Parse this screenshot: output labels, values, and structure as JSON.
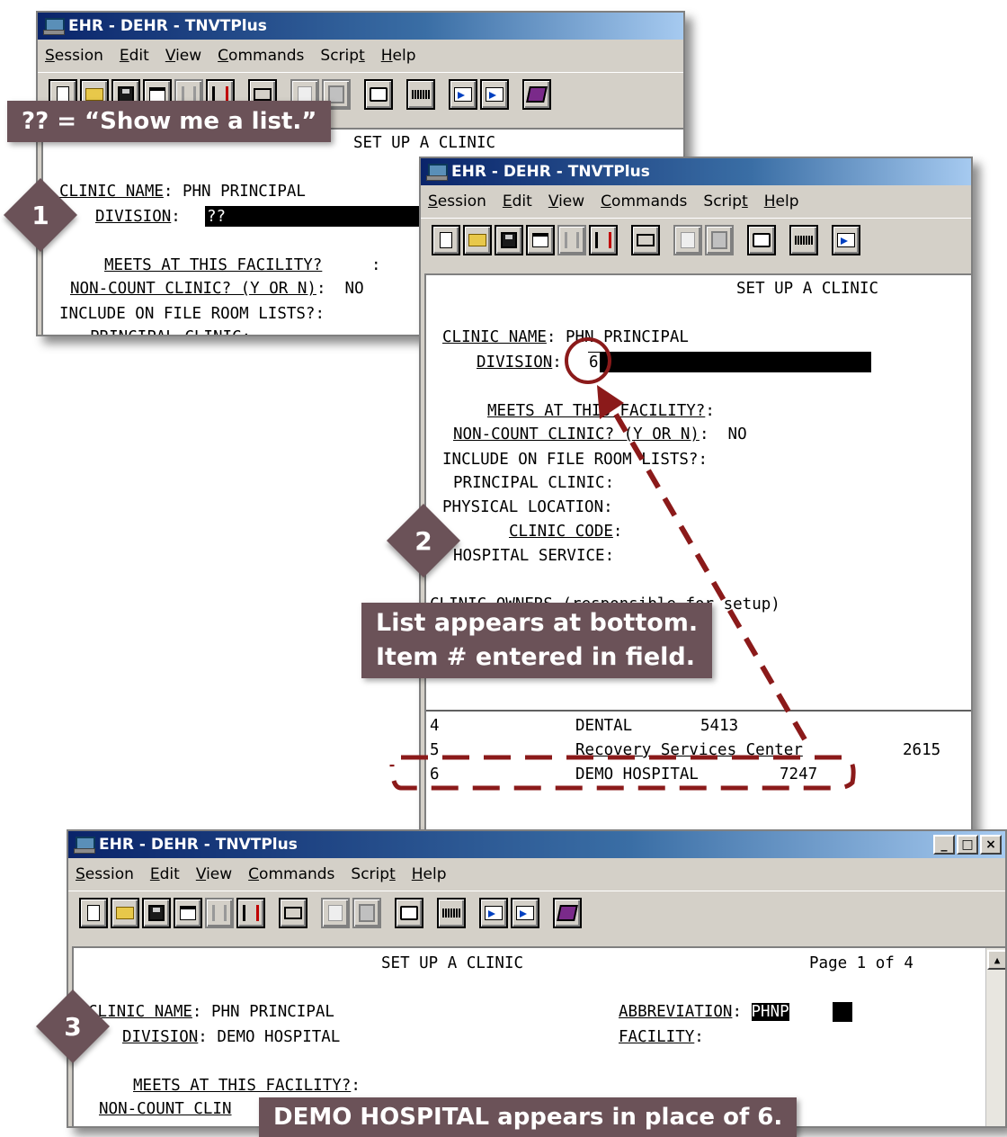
{
  "window1": {
    "title": "EHR - DEHR - TNVTPlus",
    "menu": [
      {
        "pre": "",
        "u": "S",
        "post": "ession"
      },
      {
        "pre": "",
        "u": "E",
        "post": "dit"
      },
      {
        "pre": "",
        "u": "V",
        "post": "iew"
      },
      {
        "pre": "",
        "u": "C",
        "post": "ommands"
      },
      {
        "pre": "Scrip",
        "u": "t",
        "post": ""
      },
      {
        "pre": "",
        "u": "H",
        "post": "elp"
      }
    ],
    "terminal": {
      "screen_title": "SET UP A CLINIC",
      "clinic_name_label": "CLINIC NAME",
      "clinic_name_value": "PHN PRINCIPAL",
      "division_label": "DIVISION",
      "division_value": "??",
      "meets_label": "MEETS AT THIS FACILITY?",
      "noncount_label": "NON-COUNT CLINIC? (Y OR N)",
      "noncount_value": "NO",
      "include_label": "INCLUDE ON FILE ROOM LISTS?:",
      "principal_partial": "PRINCIPAL CLINIC:"
    }
  },
  "window2": {
    "title": "EHR - DEHR - TNVTPlus",
    "terminal": {
      "screen_title": "SET UP A CLINIC",
      "clinic_name_label": "CLINIC NAME",
      "clinic_name_value": "PHN PRINCIPAL",
      "division_label": "DIVISION",
      "division_value": "6",
      "meets_label": "MEETS AT THIS FACILITY?",
      "noncount_label": "NON-COUNT CLINIC? (Y OR N)",
      "noncount_value": "NO",
      "include_label": "INCLUDE ON FILE ROOM LISTS?:",
      "principal_label": "PRINCIPAL CLINIC:",
      "physical_label": "PHYSICAL LOCATION:",
      "clinic_code_label": "CLINIC CODE",
      "hospital_service_label": "HOSPITAL SERVICE:",
      "clinic_owners_partial": "CLINIC OWNERS (responsible for setup)",
      "list": [
        {
          "num": "4",
          "name": "DENTAL",
          "code": "5413"
        },
        {
          "num": "5",
          "name": "Recovery Services Center",
          "code": "2615"
        },
        {
          "num": "6",
          "name": "DEMO HOSPITAL",
          "code": "7247"
        }
      ]
    }
  },
  "window3": {
    "title": "EHR - DEHR - TNVTPlus",
    "controls": [
      "_",
      "□",
      "×"
    ],
    "terminal": {
      "screen_title": "SET UP A CLINIC",
      "page_info": "Page 1 of 4",
      "clinic_name_label": "CLINIC NAME",
      "clinic_name_value": "PHN PRINCIPAL",
      "division_label": "DIVISION",
      "division_value": "DEMO HOSPITAL",
      "abbreviation_label": "ABBREVIATION",
      "abbreviation_value": "PHNP",
      "facility_label": "FACILITY",
      "meets_label": "MEETS AT THIS FACILITY?",
      "noncount_partial": "NON-COUNT CLIN"
    }
  },
  "callouts": {
    "c1": "?? = “Show me a list.”",
    "c2_line1": "List appears at bottom.",
    "c2_line2": "Item # entered in field.",
    "c3": "DEMO HOSPITAL appears in place of 6."
  },
  "steps": [
    "1",
    "2",
    "3"
  ],
  "colors": {
    "callout_bg": "#6b5258",
    "annotation_red": "#8b1a1a",
    "title_blue": "#0a246a",
    "window_gray": "#d4d0c8"
  }
}
